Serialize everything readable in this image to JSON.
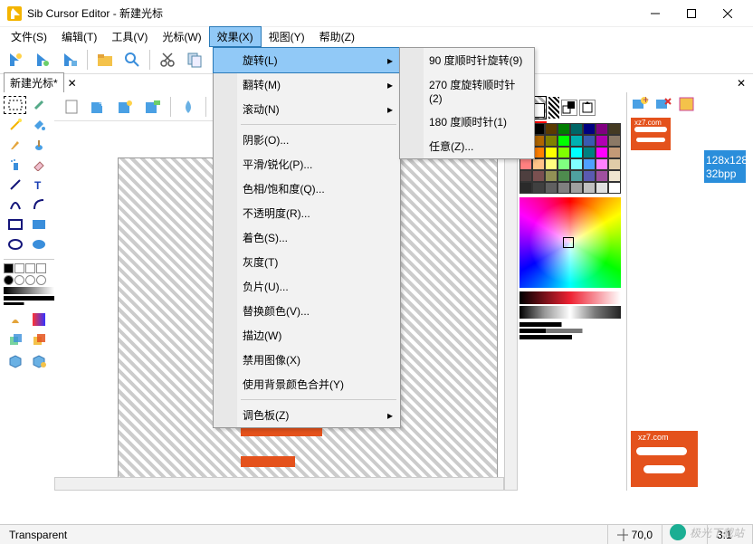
{
  "window": {
    "title": "Sib Cursor Editor - 新建光标"
  },
  "menus": [
    "文件(S)",
    "编辑(T)",
    "工具(V)",
    "光标(W)",
    "效果(X)",
    "视图(Y)",
    "帮助(Z)"
  ],
  "active_menu_index": 4,
  "dropdown": {
    "groups": [
      [
        {
          "label": "旋转(L)",
          "submenu": true,
          "hl": true
        },
        {
          "label": "翻转(M)",
          "submenu": true
        },
        {
          "label": "滚动(N)",
          "submenu": true
        }
      ],
      [
        {
          "label": "阴影(O)..."
        },
        {
          "label": "平滑/锐化(P)..."
        },
        {
          "label": "色相/饱和度(Q)..."
        },
        {
          "label": "不透明度(R)..."
        },
        {
          "label": "着色(S)..."
        },
        {
          "label": "灰度(T)"
        },
        {
          "label": "负片(U)..."
        },
        {
          "label": "替换颜色(V)..."
        },
        {
          "label": "描边(W)"
        },
        {
          "label": "禁用图像(X)"
        },
        {
          "label": "使用背景颜色合并(Y)"
        }
      ],
      [
        {
          "label": "调色板(Z)",
          "submenu": true
        }
      ]
    ]
  },
  "submenu_items": [
    "90 度顺时针旋转(9)",
    "270 度旋转顺时针(2)",
    "180 度顺时针(1)",
    "任意(Z)..."
  ],
  "tab": {
    "label": "新建光标*"
  },
  "status": {
    "transparent": "Transparent",
    "coord": "70,0",
    "zoom": "3:1"
  },
  "preview": {
    "res": "128x128",
    "bpp": "32bpp",
    "brand": "xz7.com"
  },
  "watermark": "极光下载站",
  "palette_colors": [
    "#000000",
    "#800000",
    "#5a3a00",
    "#007c00",
    "#006666",
    "#000080",
    "#800080",
    "#443a22",
    "#ff0000",
    "#b06600",
    "#808000",
    "#00ff00",
    "#00b1b1",
    "#3a5ab1",
    "#b100b1",
    "#8b7966",
    "#ff5a00",
    "#ff8000",
    "#ffff00",
    "#80ff00",
    "#00ffff",
    "#008080",
    "#ff00ff",
    "#c39a77",
    "#ff8080",
    "#ffc388",
    "#ffff80",
    "#80ff80",
    "#80ffff",
    "#4fa0ff",
    "#ff80ff",
    "#e0cca8",
    "#4e3f3f",
    "#7a5050",
    "#919155",
    "#4e8b4e",
    "#4fa0a0",
    "#5a5ab1",
    "#a050a0",
    "#f0e6d0",
    "#2a2a2a",
    "#404040",
    "#606060",
    "#808080",
    "#a0a0a0",
    "#c0c0c0",
    "#e0e0e0",
    "#ffffff"
  ]
}
